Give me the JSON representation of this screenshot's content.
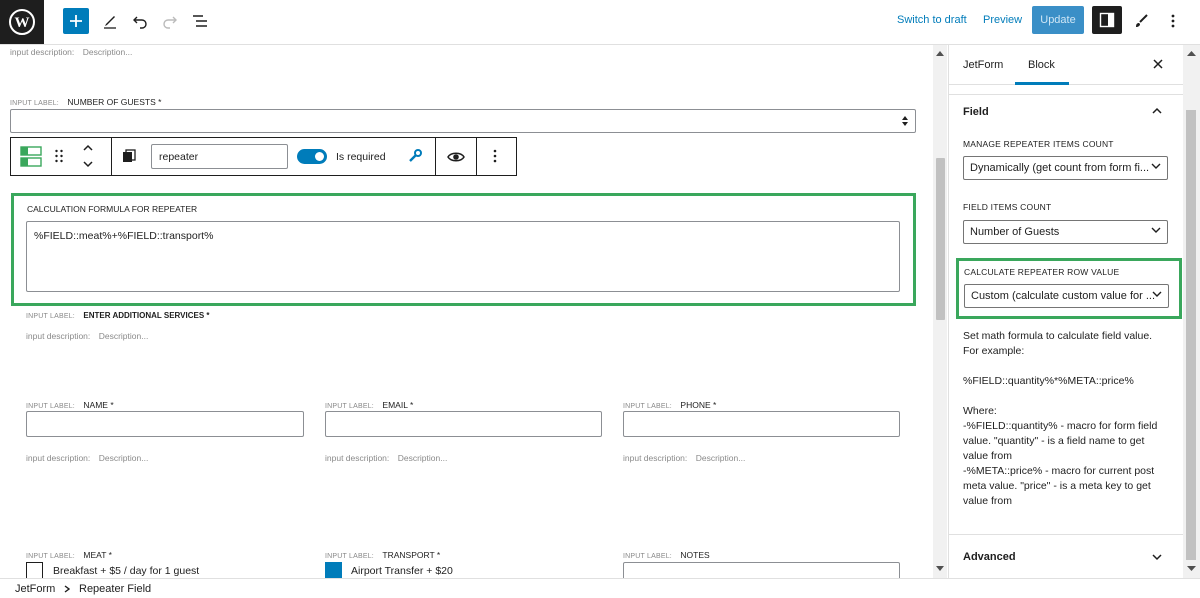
{
  "toolbar": {
    "switch_to_draft": "Switch to draft",
    "preview": "Preview",
    "update": "Update",
    "accent": "#007cba"
  },
  "canvas": {
    "top_desc": {
      "small": "input description:",
      "text": "Description..."
    },
    "guests": {
      "small": "INPUT LABEL:",
      "label": "NUMBER OF GUESTS *"
    },
    "block_toolbar": {
      "name_value": "repeater",
      "required_label": "Is required"
    },
    "calc_label": "CALCULATION FORMULA FOR REPEATER",
    "calc_value": "%FIELD::meat%+%FIELD::transport%",
    "additional": {
      "small": "INPUT LABEL:",
      "label": "ENTER ADDITIONAL SERVICES *",
      "desc_small": "input description:",
      "desc": "Description..."
    },
    "fields": [
      {
        "small": "INPUT LABEL:",
        "label": "NAME *",
        "desc_small": "input description:",
        "desc": "Description..."
      },
      {
        "small": "INPUT LABEL:",
        "label": "EMAIL *",
        "desc_small": "input description:",
        "desc": "Description..."
      },
      {
        "small": "INPUT LABEL:",
        "label": "PHONE *",
        "desc_small": "input description:",
        "desc": "Description..."
      }
    ],
    "row2": [
      {
        "small": "INPUT LABEL:",
        "label": "MEAT *",
        "option": "Breakfast + $5 / day for 1 guest"
      },
      {
        "small": "INPUT LABEL:",
        "label": "TRANSPORT *",
        "option": "Airport Transfer + $20"
      },
      {
        "small": "INPUT LABEL:",
        "label": "NOTES"
      }
    ]
  },
  "sidebar": {
    "tabs": [
      "JetForm",
      "Block"
    ],
    "panel_title": "Field",
    "manage_label": "MANAGE REPEATER ITEMS COUNT",
    "manage_value": "Dynamically (get count from form fi...",
    "items_count_label": "FIELD ITEMS COUNT",
    "items_count_value": "Number of Guests",
    "row_value_label": "CALCULATE REPEATER ROW VALUE",
    "row_value_value": "Custom (calculate custom value for ...",
    "help_line1": "Set math formula to calculate field value.",
    "help_line2": "For example:",
    "help_example": "%FIELD::quantity%*%META::price%",
    "help_where": "Where:",
    "help_w1": "-%FIELD::quantity% - macro for form field",
    "help_w2": "value. \"quantity\" - is a field name to get",
    "help_w3": "value from",
    "help_w4": "-%META::price% - macro for current post",
    "help_w5": "meta value. \"price\" - is a meta key to get",
    "help_w6": "value from",
    "advanced": "Advanced"
  },
  "breadcrumb": [
    "JetForm",
    "Repeater Field"
  ],
  "highlight_color": "#3aa75c"
}
